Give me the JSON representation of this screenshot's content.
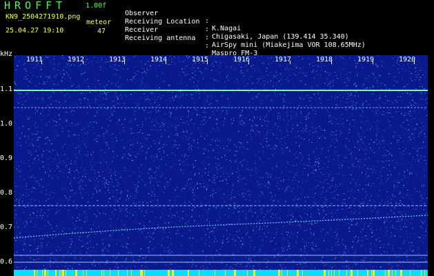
{
  "header": {
    "app_title": "HROFFT",
    "version": "1.00f",
    "filename": "KN9_2504271910.png",
    "datetime": "25.04.27 19:10",
    "mode_label": "meteor",
    "count": "47"
  },
  "info": [
    {
      "label": "Observer",
      "value": "K.Nagai"
    },
    {
      "label": "Receiving Location",
      "value": "Chigasaki, Japan (139.414 35.340)"
    },
    {
      "label": "Receiver",
      "value": "AirSpy mini (Miakejima VOR 108.65MHz)"
    },
    {
      "label": "Receiving antenna",
      "value": "Maspro FM-3"
    }
  ],
  "spectrogram": {
    "y_unit": "kHz",
    "y_ticks": [
      "1.1",
      "1.0",
      "0.9",
      "0.8",
      "0.7",
      "0.6"
    ],
    "x_ticks": [
      "1911",
      "1912",
      "1913",
      "1914",
      "1915",
      "1916",
      "1917",
      "1918",
      "1919",
      "1920"
    ],
    "colors": {
      "background": "#0a1a8c",
      "carrier": "#7cffb0",
      "strip": "#00e0ff",
      "marker": "#ffff00"
    }
  }
}
